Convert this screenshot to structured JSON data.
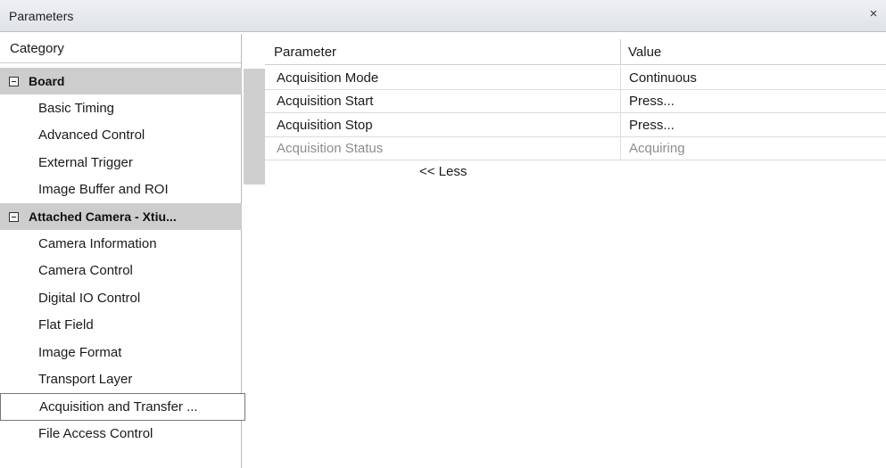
{
  "window": {
    "title": "Parameters",
    "close_glyph": "×"
  },
  "category_panel": {
    "header": "Category",
    "groups": [
      {
        "label": "Board",
        "expanded": true,
        "items": [
          "Basic Timing",
          "Advanced Control",
          "External Trigger",
          "Image Buffer and ROI"
        ]
      },
      {
        "label": "Attached Camera - Xtiu...",
        "expanded": true,
        "items": [
          "Camera Information",
          "Camera Control",
          "Digital IO Control",
          "Flat Field",
          "Image Format",
          "Transport Layer",
          "Acquisition and Transfer ...",
          "File Access Control"
        ]
      }
    ],
    "selected_item": "Acquisition and Transfer ..."
  },
  "grid": {
    "columns": {
      "parameter": "Parameter",
      "value": "Value"
    },
    "rows": [
      {
        "parameter": "Acquisition Mode",
        "value": "Continuous",
        "enabled": true
      },
      {
        "parameter": "Acquisition Start",
        "value": "Press...",
        "enabled": true
      },
      {
        "parameter": "Acquisition Stop",
        "value": "Press...",
        "enabled": true
      },
      {
        "parameter": "Acquisition Status",
        "value": "Acquiring",
        "enabled": false
      }
    ],
    "less_link": "<< Less"
  }
}
